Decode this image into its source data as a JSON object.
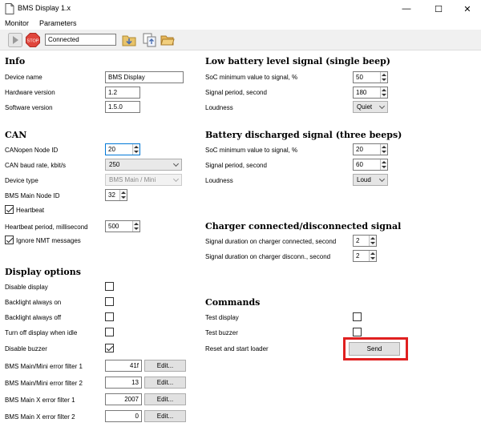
{
  "window": {
    "title": "BMS Display 1.x",
    "minimize": "—",
    "maximize": "☐",
    "close": "✕"
  },
  "menu": {
    "monitor": "Monitor",
    "parameters": "Parameters"
  },
  "toolbar": {
    "status": "Connected"
  },
  "info": {
    "title": "Info",
    "device_name_label": "Device name",
    "device_name": "BMS Display",
    "hardware_label": "Hardware version",
    "hardware": "1.2",
    "software_label": "Software version",
    "software": "1.5.0"
  },
  "can": {
    "title": "CAN",
    "node_id_label": "CANopen Node ID",
    "node_id": "20",
    "baud_label": "CAN baud rate, kbit/s",
    "baud": "250",
    "device_type_label": "Device type",
    "device_type": "BMS Main / Mini",
    "main_node_label": "BMS Main Node ID",
    "main_node": "32",
    "heartbeat_label": "Heartbeat",
    "heartbeat_checked": true,
    "hb_period_label": "Heartbeat period, millisecond",
    "hb_period": "500",
    "ignore_nmt_label": "Ignore NMT messages",
    "ignore_nmt_checked": true
  },
  "display": {
    "title": "Display options",
    "disable_display": "Disable display",
    "backlight_on": "Backlight always on",
    "backlight_off": "Backlight always off",
    "turn_off_idle": "Turn off display when idle",
    "disable_buzzer": "Disable buzzer",
    "filter1_label": "BMS Main/Mini error filter 1",
    "filter1": "41f",
    "filter2_label": "BMS Main/Mini error filter 2",
    "filter2": "13",
    "filter3_label": "BMS Main X error filter 1",
    "filter3": "2007",
    "filter4_label": "BMS Main X error filter 2",
    "filter4": "0",
    "edit_label": "Edit..."
  },
  "low_battery": {
    "title": "Low battery level signal (single beep)",
    "soc_label": "SoC minimum value to signal, %",
    "soc": "50",
    "period_label": "Signal period, second",
    "period": "180",
    "loudness_label": "Loudness",
    "loudness": "Quiet"
  },
  "discharged": {
    "title": "Battery discharged signal (three beeps)",
    "soc_label": "SoC minimum value to signal, %",
    "soc": "20",
    "period_label": "Signal period, second",
    "period": "60",
    "loudness_label": "Loudness",
    "loudness": "Loud"
  },
  "charger": {
    "title": "Charger connected/disconnected signal",
    "connected_label": "Signal duration on charger connected, second",
    "connected": "2",
    "disconnected_label": "Signal duration on charger disconn., second",
    "disconnected": "2"
  },
  "commands": {
    "title": "Commands",
    "test_display": "Test display",
    "test_buzzer": "Test buzzer",
    "reset_label": "Reset and start loader",
    "send_label": "Send"
  },
  "colors": {
    "highlight": "#e02020",
    "focus": "#0078d7"
  }
}
